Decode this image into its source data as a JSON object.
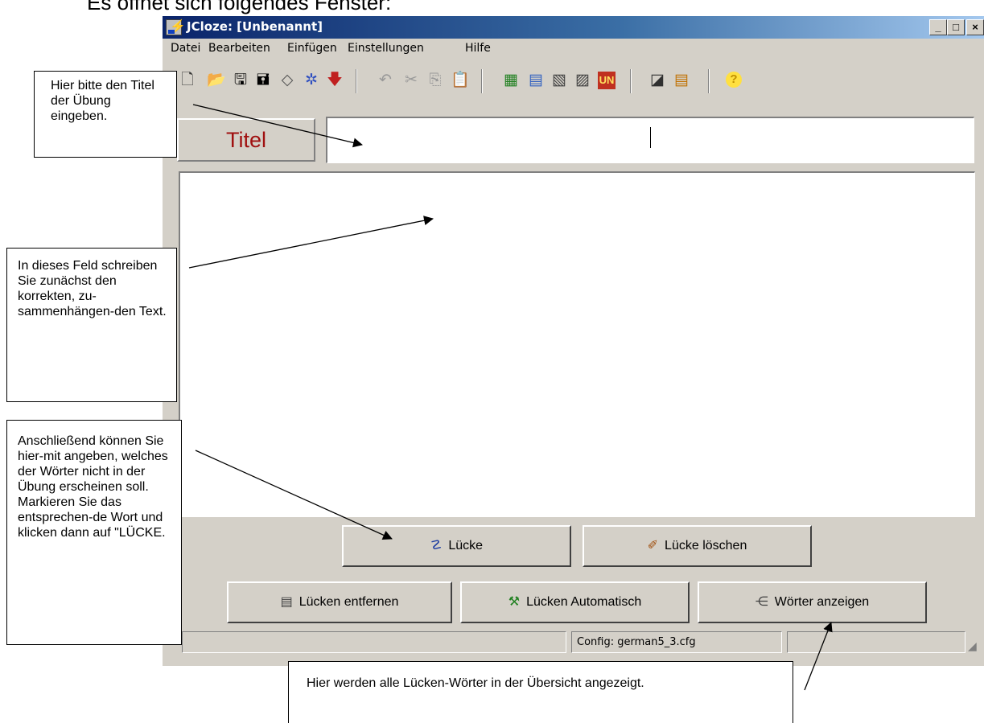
{
  "heading": "Es öffnet sich folgendes Fenster:",
  "window": {
    "title": "JCloze: [Unbenannt]",
    "minimize_glyph": "_",
    "maximize_glyph": "□",
    "close_glyph": "×"
  },
  "menu": [
    "Datei",
    "Bearbeiten",
    "Einfügen",
    "Einstellungen",
    "Hilfe"
  ],
  "toolbar_icons": [
    "new-document-icon",
    "open-folder-icon",
    "save-icon",
    "save-as-icon",
    "eraser-icon",
    "web-export-icon",
    "arrow-down-icon",
    "undo-icon",
    "cut-icon",
    "copy-icon",
    "paste-icon",
    "gap-icon-1",
    "gap-icon-2",
    "gap-icon-3",
    "gap-icon-4",
    "un-icon",
    "config-icon",
    "export-icon",
    "help-icon"
  ],
  "title_field": {
    "label": "Titel",
    "value": ""
  },
  "text_area": {
    "value": ""
  },
  "buttons": {
    "luecke": "Lücke",
    "luecke_loeschen": "Lücke löschen",
    "luecken_entfernen": "Lücken entfernen",
    "luecken_automatisch": "Lücken Automatisch",
    "woerter_anzeigen": "Wörter anzeigen"
  },
  "status": {
    "config": "Config: german5_3.cfg"
  },
  "callouts": {
    "title": "Hier bitte den Titel der Übung eingeben.",
    "text": "In dieses Feld schreiben Sie zunächst den korrekten, zu-sammenhängen-den Text.",
    "gap": "Anschließend können Sie hier-mit angeben, welches der Wörter nicht in der Übung erscheinen soll. Markieren Sie das entsprechen-de Wort und klicken dann auf \"LÜCKE.",
    "words": "Hier werden alle Lücken-Wörter in der Übersicht angezeigt."
  }
}
